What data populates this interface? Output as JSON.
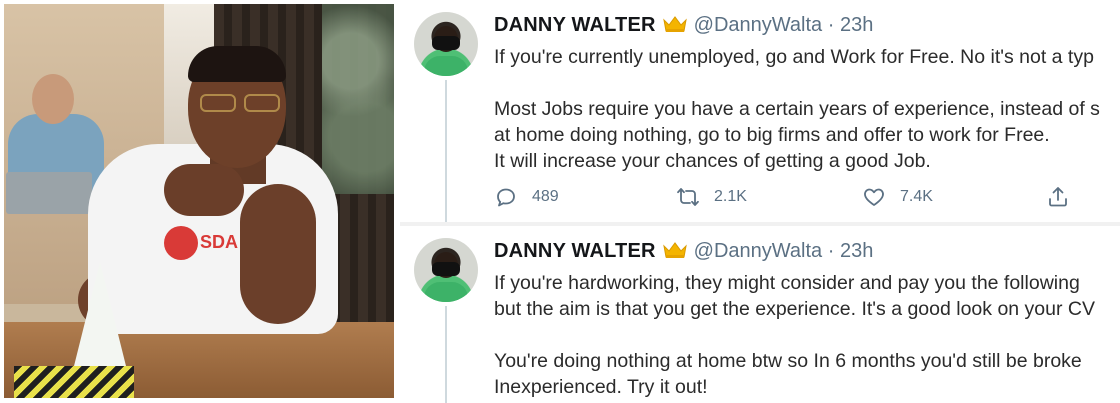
{
  "photo": {
    "logo_text": "SDA"
  },
  "tweets": [
    {
      "name": "DANNY WALTER",
      "badge_icon": "crown-icon",
      "handle": "@DannyWalta",
      "separator": "·",
      "time": "23h",
      "lines": [
        "If you're currently unemployed, go and Work for Free. No it's not a typ",
        "Most Jobs require you have a certain years of experience, instead of s",
        "at home doing nothing, go to big firms and offer to work for Free.",
        "It will increase your chances of getting a good Job."
      ],
      "actions": {
        "reply_icon": "reply-icon",
        "replies": "489",
        "retweet_icon": "retweet-icon",
        "retweets": "2.1K",
        "like_icon": "heart-icon",
        "likes": "7.4K",
        "share_icon": "share-icon"
      }
    },
    {
      "name": "DANNY WALTER",
      "badge_icon": "crown-icon",
      "handle": "@DannyWalta",
      "separator": "·",
      "time": "23h",
      "lines": [
        "If you're hardworking, they might consider and pay you the following",
        "but the aim is that you get the experience. It's a good look on your CV",
        "You're doing nothing at home btw so In 6 months you'd still be broke",
        "Inexperienced. Try it out!"
      ]
    }
  ],
  "colors": {
    "name": "#141619",
    "secondary_text": "#5b7083",
    "body_text": "#2b2b2b",
    "crown": "#f4b400",
    "thread_line": "#cfd9de"
  }
}
